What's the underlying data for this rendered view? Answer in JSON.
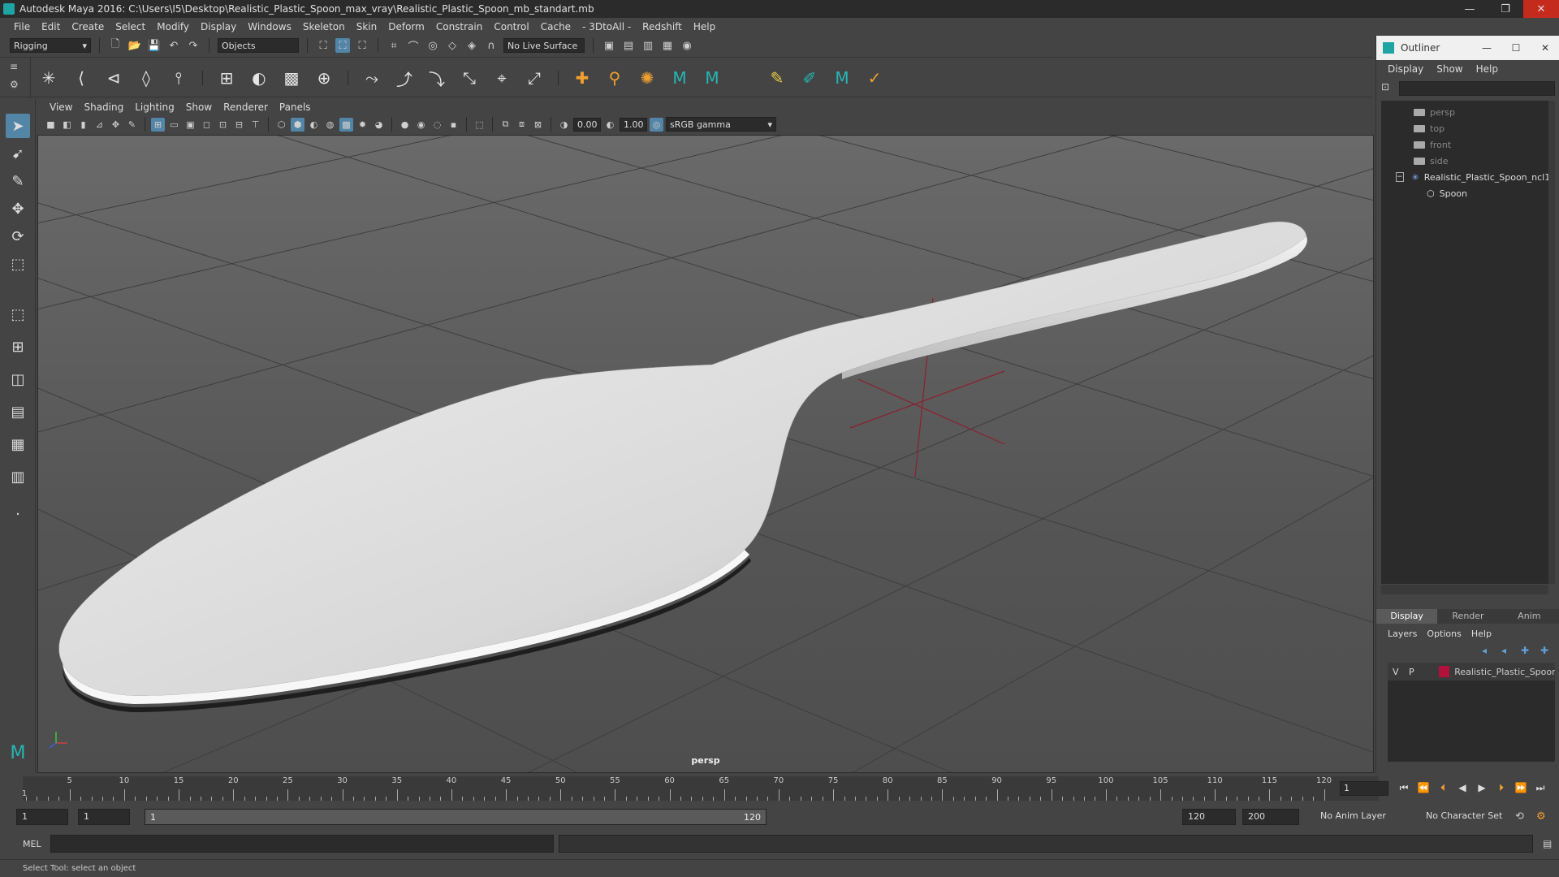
{
  "window": {
    "title": "Autodesk Maya 2016: C:\\Users\\I5\\Desktop\\Realistic_Plastic_Spoon_max_vray\\Realistic_Plastic_Spoon_mb_standart.mb",
    "minimize": "—",
    "restore": "❐",
    "close": "✕"
  },
  "menubar": [
    "File",
    "Edit",
    "Create",
    "Select",
    "Modify",
    "Display",
    "Windows",
    "Skeleton",
    "Skin",
    "Deform",
    "Constrain",
    "Control",
    "Cache",
    "- 3DtoAll -",
    "Redshift",
    "Help"
  ],
  "statusline": {
    "menuset": "Rigging",
    "selection_mode": "Objects",
    "live_surface": "No Live Surface"
  },
  "viewport": {
    "panel_menu": [
      "View",
      "Shading",
      "Lighting",
      "Show",
      "Renderer",
      "Panels"
    ],
    "exposure": "0.00",
    "gamma": "1.00",
    "color_space": "sRGB gamma",
    "camera_label": "persp"
  },
  "outliner": {
    "title": "Outliner",
    "menu": [
      "Display",
      "Show",
      "Help"
    ],
    "items": [
      {
        "label": "persp"
      },
      {
        "label": "top"
      },
      {
        "label": "front"
      },
      {
        "label": "side"
      },
      {
        "label": "Realistic_Plastic_Spoon_ncl1"
      },
      {
        "label": "Spoon"
      }
    ]
  },
  "layer_editor": {
    "tabs": [
      "Display",
      "Render",
      "Anim"
    ],
    "menu": [
      "Layers",
      "Options",
      "Help"
    ],
    "layer": {
      "v": "V",
      "p": "P",
      "name": "Realistic_Plastic_Spoon",
      "color": "#b0123a"
    }
  },
  "timeslider": {
    "labels": [
      "5",
      "10",
      "15",
      "20",
      "25",
      "30",
      "35",
      "40",
      "45",
      "50",
      "55",
      "60",
      "65",
      "70",
      "75",
      "80",
      "85",
      "90",
      "95",
      "100",
      "105",
      "110",
      "115",
      "120"
    ],
    "start_label": "1",
    "current_frame": "1"
  },
  "rangeslider": {
    "start": "1",
    "playback_start": "1",
    "range_start": "1",
    "range_end": "120",
    "playback_end": "120",
    "end": "200",
    "anim_layer": "No Anim Layer",
    "character_set": "No Character Set"
  },
  "cmdline": {
    "label": "MEL"
  },
  "helpline": {
    "text": "Select Tool: select an object"
  }
}
